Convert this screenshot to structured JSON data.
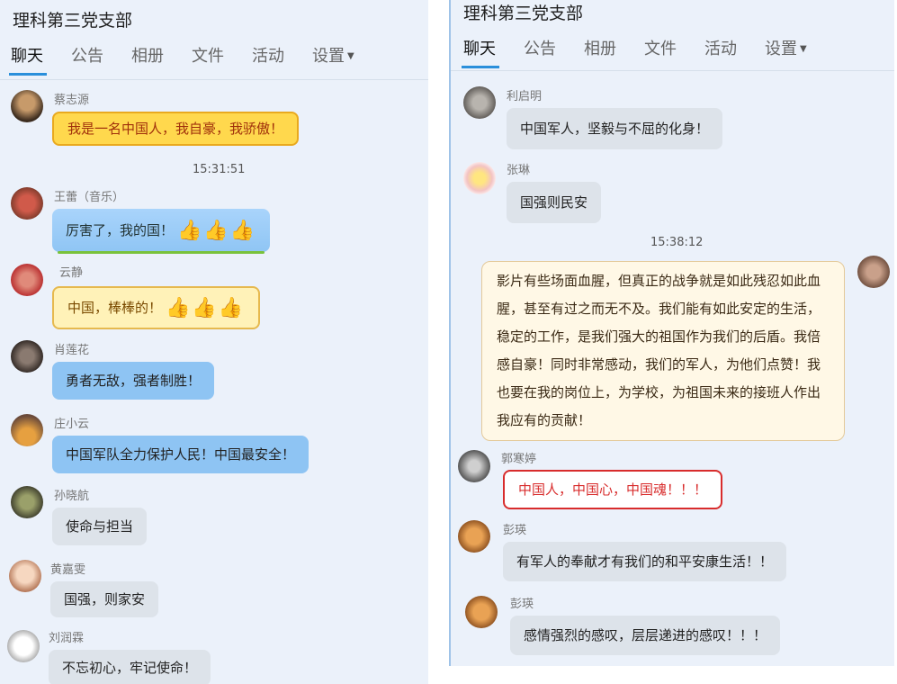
{
  "left": {
    "title": "理科第三党支部",
    "tabs": [
      "聊天",
      "公告",
      "相册",
      "文件",
      "活动",
      "设置"
    ],
    "time": "15:31:51",
    "messages": [
      {
        "sender": "蔡志源",
        "text": "我是一名中国人，我自豪，我骄傲！"
      },
      {
        "sender": "王蕾（音乐）",
        "text": "厉害了，我的国！",
        "thumbs": "👍👍👍"
      },
      {
        "sender": "云静",
        "text": "中国，棒棒的！",
        "thumbs": "👍👍👍"
      },
      {
        "sender": "肖莲花",
        "text": "勇者无敌，强者制胜！"
      },
      {
        "sender": "庄小云",
        "text": "中国军队全力保护人民！中国最安全！"
      },
      {
        "sender": "孙晓航",
        "text": "使命与担当"
      },
      {
        "sender": "黄嘉雯",
        "text": "国强，则家安"
      },
      {
        "sender": "刘润霖",
        "text": "不忘初心，牢记使命！"
      }
    ]
  },
  "right": {
    "title": "理科第三党支部",
    "tabs": [
      "聊天",
      "公告",
      "相册",
      "文件",
      "活动",
      "设置"
    ],
    "time": "15:38:12",
    "messages": [
      {
        "sender": "利启明",
        "text": "中国军人，坚毅与不屈的化身！"
      },
      {
        "sender": "张琳",
        "text": "国强则民安"
      },
      {
        "sender": "",
        "text": "影片有些场面血腥，但真正的战争就是如此残忍如此血腥，甚至有过之而无不及。我们能有如此安定的生活，稳定的工作，是我们强大的祖国作为我们的后盾。我倍感自豪！同时非常感动，我们的军人，为他们点赞！我也要在我的岗位上，为学校，为祖国未来的接班人作出我应有的贡献！"
      },
      {
        "sender": "郭寒婷",
        "text": "中国人，中国心，中国魂！！！"
      },
      {
        "sender": "彭瑛",
        "text": "有军人的奉献才有我们的和平安康生活！！"
      },
      {
        "sender": "彭瑛",
        "text": "感情强烈的感叹，层层递进的感叹！！！"
      }
    ]
  },
  "caret_icon": "caret-down-icon",
  "colors": {
    "accent": "#2a8fdb",
    "panel": "#ebf1fa",
    "red": "#d82c2c"
  }
}
